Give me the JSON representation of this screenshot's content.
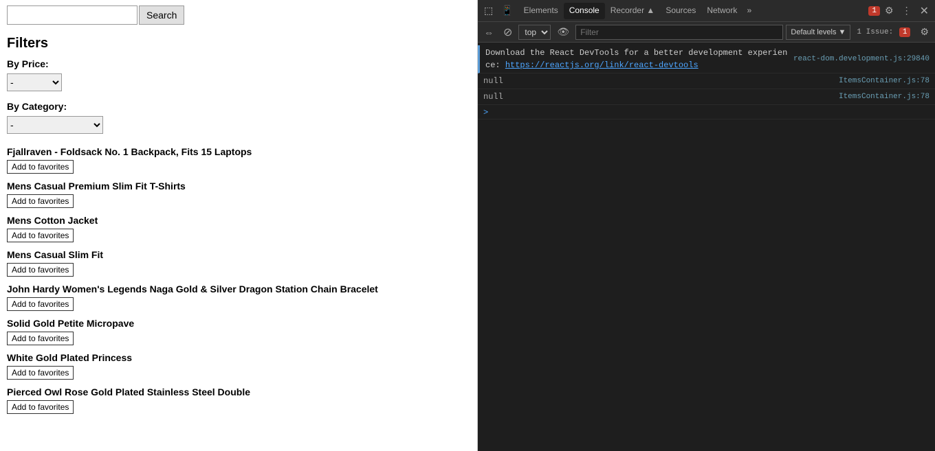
{
  "app": {
    "search": {
      "placeholder": "",
      "button_label": "Search"
    },
    "filters": {
      "title": "Filters",
      "price_label": "By Price:",
      "price_option": "-",
      "category_label": "By Category:",
      "category_option": "-"
    },
    "products": [
      {
        "name": "Fjallraven - Foldsack No. 1 Backpack, Fits 15 Laptops",
        "btn": "Add to favorites"
      },
      {
        "name": "Mens Casual Premium Slim Fit T-Shirts",
        "btn": "Add to favorites"
      },
      {
        "name": "Mens Cotton Jacket",
        "btn": "Add to favorites"
      },
      {
        "name": "Mens Casual Slim Fit",
        "btn": "Add to favorites"
      },
      {
        "name": "John Hardy Women's Legends Naga Gold & Silver Dragon Station Chain Bracelet",
        "btn": "Add to favorites"
      },
      {
        "name": "Solid Gold Petite Micropave",
        "btn": "Add to favorites"
      },
      {
        "name": "White Gold Plated Princess",
        "btn": "Add to favorites"
      },
      {
        "name": "Pierced Owl Rose Gold Plated Stainless Steel Double",
        "btn": "Add to favorites"
      }
    ]
  },
  "devtools": {
    "tabs": [
      "Elements",
      "Console",
      "Recorder ▲",
      "Sources",
      "Network"
    ],
    "active_tab": "Console",
    "more_label": "»",
    "issue_badge": "1",
    "gear_icon": "⚙",
    "three_dot_icon": "⋮",
    "close_icon": "✕",
    "second_bar": {
      "frame_icon": "⇔",
      "circle_icon": "⊘",
      "frame_option": "top",
      "eye_icon": "👁",
      "filter_placeholder": "Filter",
      "levels_label": "Default levels",
      "levels_arrow": "▼",
      "issue_label": "1 Issue:",
      "issue_count": "1",
      "settings_icon": "⚙"
    },
    "console_entries": [
      {
        "type": "info",
        "text": "Download the React DevTools for a better development experience: ",
        "link_text": "https://reactjs.org/link/react-devtools",
        "link_url": "#",
        "text_suffix": "",
        "file": "react-dom.development.js:29840",
        "is_link_entry": true
      },
      {
        "type": "null",
        "text": "null",
        "file": "ItemsContainer.js:78",
        "is_link_entry": false
      },
      {
        "type": "null",
        "text": "null",
        "file": "ItemsContainer.js:78",
        "is_link_entry": false
      }
    ],
    "arrow_entry": {
      "symbol": ">"
    }
  }
}
